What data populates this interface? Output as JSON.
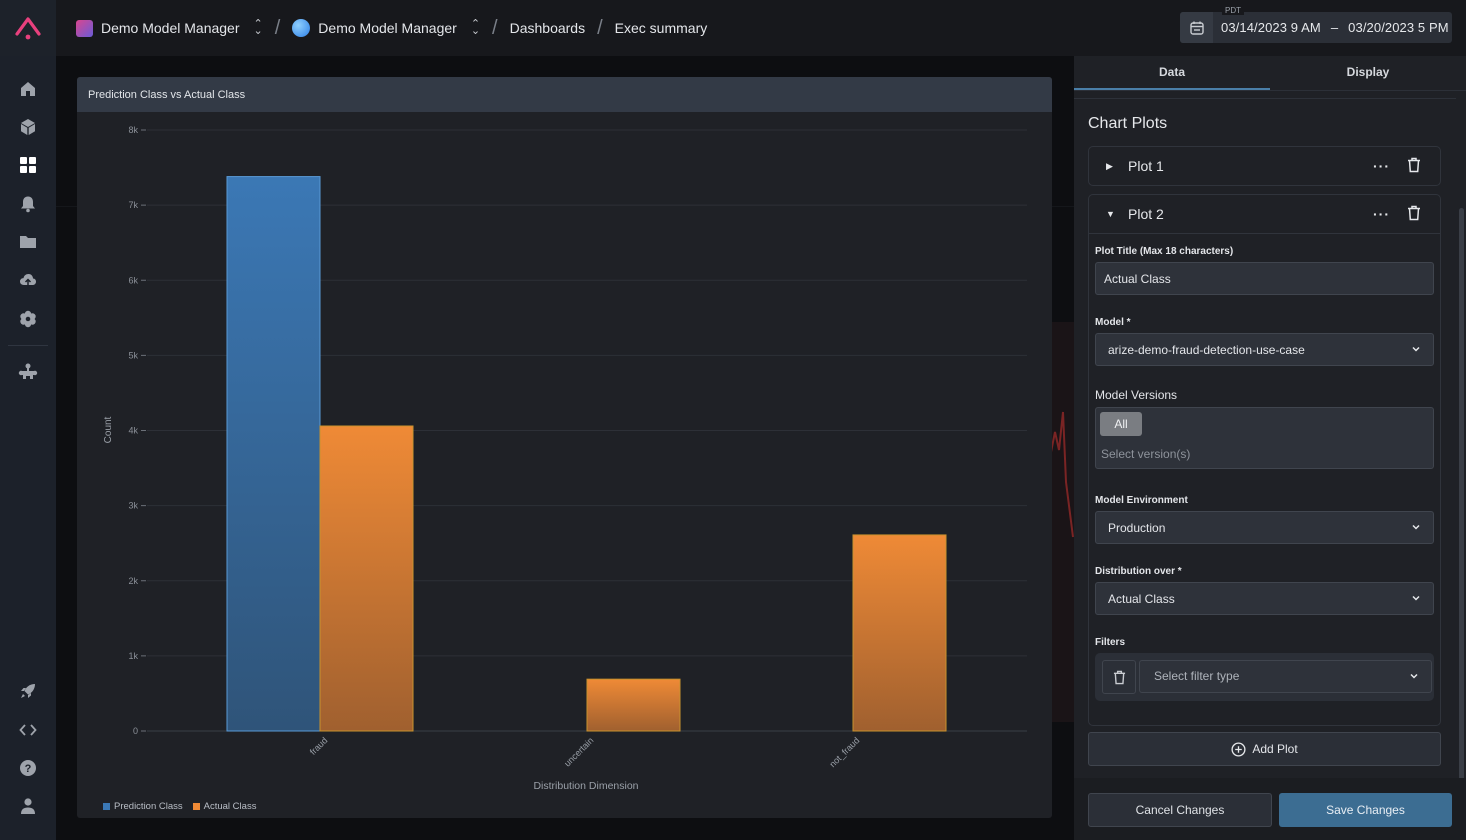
{
  "topbar": {
    "breadcrumbs": [
      {
        "label": "Demo Model Manager",
        "icon": "space-icon",
        "switcher": true
      },
      {
        "label": "Demo Model Manager",
        "icon": "org-icon",
        "switcher": true
      },
      {
        "label": "Dashboards"
      },
      {
        "label": "Exec summary"
      }
    ],
    "separator": "/",
    "date_range": {
      "timezone": "PDT",
      "start": "03/14/2023 9 AM",
      "dash": "–",
      "end": "03/20/2023 5 PM"
    }
  },
  "sidebar": {
    "items": [
      {
        "icon": "home-icon"
      },
      {
        "icon": "models-cube-icon"
      },
      {
        "icon": "dashboards-grid-icon",
        "active": true
      },
      {
        "icon": "monitors-bell-icon"
      },
      {
        "icon": "folder-icon"
      },
      {
        "icon": "upload-cloud-icon"
      },
      {
        "icon": "settings-gear-icon"
      },
      {
        "icon": "integrations-icon"
      }
    ],
    "bottom_items": [
      {
        "icon": "rocket-icon"
      },
      {
        "icon": "code-icon"
      },
      {
        "icon": "help-icon"
      },
      {
        "icon": "user-icon"
      }
    ]
  },
  "chart_card": {
    "title": "Prediction Class vs Actual Class"
  },
  "chart_data": {
    "type": "bar",
    "title": "Prediction Class vs Actual Class",
    "xlabel": "Distribution Dimension",
    "ylabel": "Count",
    "categories": [
      "fraud",
      "uncertain",
      "not_fraud"
    ],
    "series": [
      {
        "name": "Prediction Class",
        "color": "#3b78b5",
        "values": [
          7380,
          0,
          0
        ]
      },
      {
        "name": "Actual Class",
        "color": "#ef8a36",
        "values": [
          4060,
          690,
          2610
        ]
      }
    ],
    "ylim": [
      0,
      8000
    ],
    "yticks": [
      0,
      1000,
      2000,
      3000,
      4000,
      5000,
      6000,
      7000,
      8000
    ],
    "ytick_labels": [
      "0",
      "1k",
      "2k",
      "3k",
      "4k",
      "5k",
      "6k",
      "7k",
      "8k"
    ],
    "grid": true,
    "legend": "bottom-left"
  },
  "panel": {
    "tabs": [
      {
        "label": "Data",
        "active": true
      },
      {
        "label": "Display",
        "active": false
      }
    ],
    "section_title": "Chart Plots",
    "plots": [
      {
        "label": "Plot 1",
        "expanded": false
      },
      {
        "label": "Plot 2",
        "expanded": true
      }
    ],
    "form": {
      "plot_title_label": "Plot Title (Max 18 characters)",
      "plot_title_value": "Actual Class",
      "model_label": "Model *",
      "model_value": "arize-demo-fraud-detection-use-case",
      "versions_label": "Model Versions",
      "versions_chip": "All",
      "versions_placeholder": "Select version(s)",
      "environment_label": "Model Environment",
      "environment_value": "Production",
      "distribution_label": "Distribution over *",
      "distribution_value": "Actual Class",
      "filters_label": "Filters",
      "filter_placeholder": "Select filter type"
    },
    "add_plot_label": "Add Plot",
    "cancel_label": "Cancel Changes",
    "save_label": "Save Changes"
  }
}
